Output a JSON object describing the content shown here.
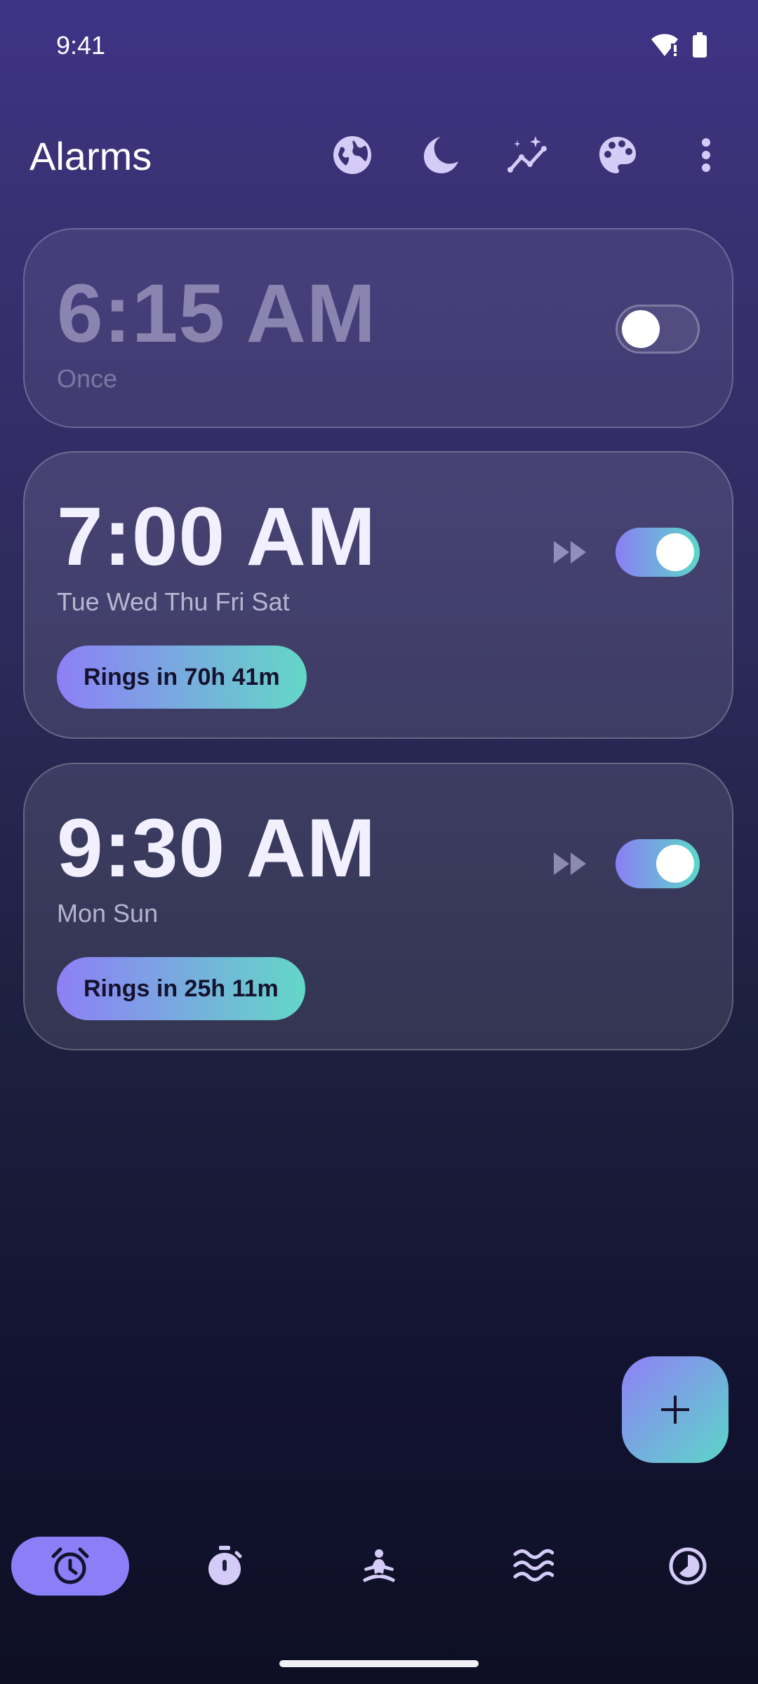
{
  "status_bar": {
    "time": "9:41",
    "icons": [
      "wifi-alert-icon",
      "battery-icon"
    ]
  },
  "app_bar": {
    "title": "Alarms",
    "actions": [
      "globe-icon",
      "moon-icon",
      "sparkle-chart-icon",
      "palette-icon",
      "more-vert-icon"
    ]
  },
  "alarms": [
    {
      "time": "6:15 AM",
      "days": "Once",
      "enabled": false,
      "ring_text": ""
    },
    {
      "time": "7:00 AM",
      "days": "Tue Wed Thu Fri Sat",
      "enabled": true,
      "ring_text": "Rings in 70h 41m"
    },
    {
      "time": "9:30 AM",
      "days": "Mon Sun",
      "enabled": true,
      "ring_text": "Rings in 25h 11m"
    }
  ],
  "fab": {
    "icon": "plus-icon"
  },
  "bottom_nav": {
    "items": [
      "alarm-icon",
      "stopwatch-icon",
      "meditation-icon",
      "waves-icon",
      "timer-icon"
    ],
    "active_index": 0
  },
  "colors": {
    "accent_purple": "#8a7ff7",
    "accent_teal": "#5ad8c8",
    "icon_lavender": "#d4ccf7"
  }
}
